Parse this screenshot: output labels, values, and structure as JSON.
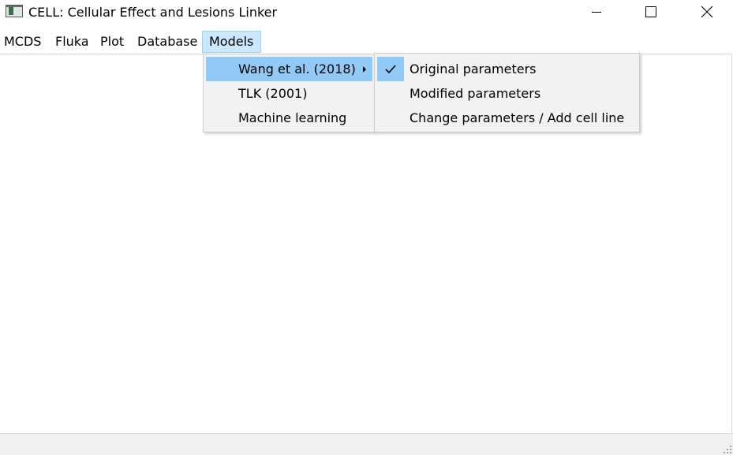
{
  "window": {
    "title": "CELL: Cellular Effect and Lesions Linker",
    "icon": "app-window-icon",
    "controls": [
      "minimize-icon",
      "maximize-icon",
      "close-icon"
    ]
  },
  "menubar": {
    "items": [
      {
        "label": "MCDS"
      },
      {
        "label": "Fluka"
      },
      {
        "label": "Plot"
      },
      {
        "label": "Database"
      },
      {
        "label": "Models",
        "active": true
      }
    ]
  },
  "models_menu": {
    "items": [
      {
        "label": "Wang et al. (2018)",
        "highlighted": true,
        "has_submenu": true
      },
      {
        "label": "TLK (2001)"
      },
      {
        "label": "Machine learning"
      }
    ]
  },
  "wang_submenu": {
    "items": [
      {
        "label": "Original parameters",
        "checked": true,
        "icon": "checkmark-icon"
      },
      {
        "label": "Modified parameters"
      },
      {
        "label": "Change parameters / Add cell line"
      }
    ]
  },
  "colors": {
    "menu_highlight": "#91c9f7",
    "menubar_active": "#cce8ff",
    "menu_background": "#f2f2f2",
    "statusbar": "#f0f0f0"
  }
}
